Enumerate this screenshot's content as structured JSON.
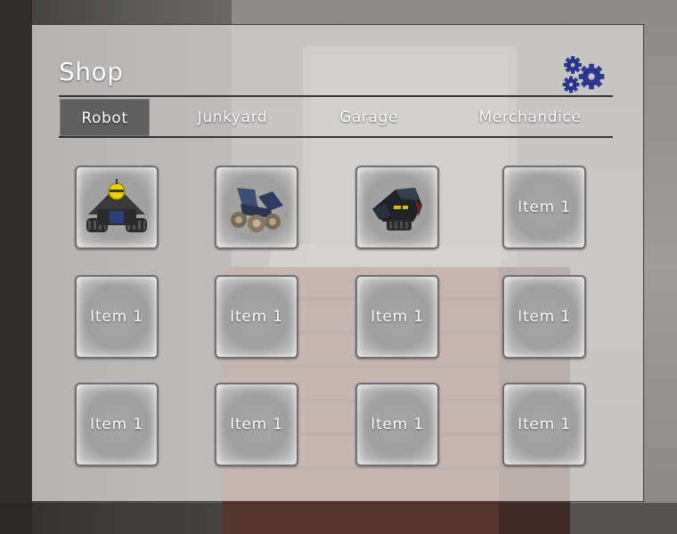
{
  "shop": {
    "title": "Shop",
    "settings_icon": "gears-icon",
    "accent_color": "#2e3a9a"
  },
  "tabs": [
    {
      "label": "Robot",
      "active": true
    },
    {
      "label": "Junkyard",
      "active": false
    },
    {
      "label": "Garage",
      "active": false
    },
    {
      "label": "Merchandice",
      "active": false
    }
  ],
  "items": [
    {
      "image": "robot-tracked-yellow-head-icon"
    },
    {
      "image": "robot-wheeled-blue-icon"
    },
    {
      "image": "robot-dark-armored-icon"
    },
    {
      "label": "Item 1"
    },
    {
      "label": "Item 1"
    },
    {
      "label": "Item 1"
    },
    {
      "label": "Item 1"
    },
    {
      "label": "Item 1"
    },
    {
      "label": "Item 1"
    },
    {
      "label": "Item 1"
    },
    {
      "label": "Item 1"
    },
    {
      "label": "Item 1"
    }
  ]
}
